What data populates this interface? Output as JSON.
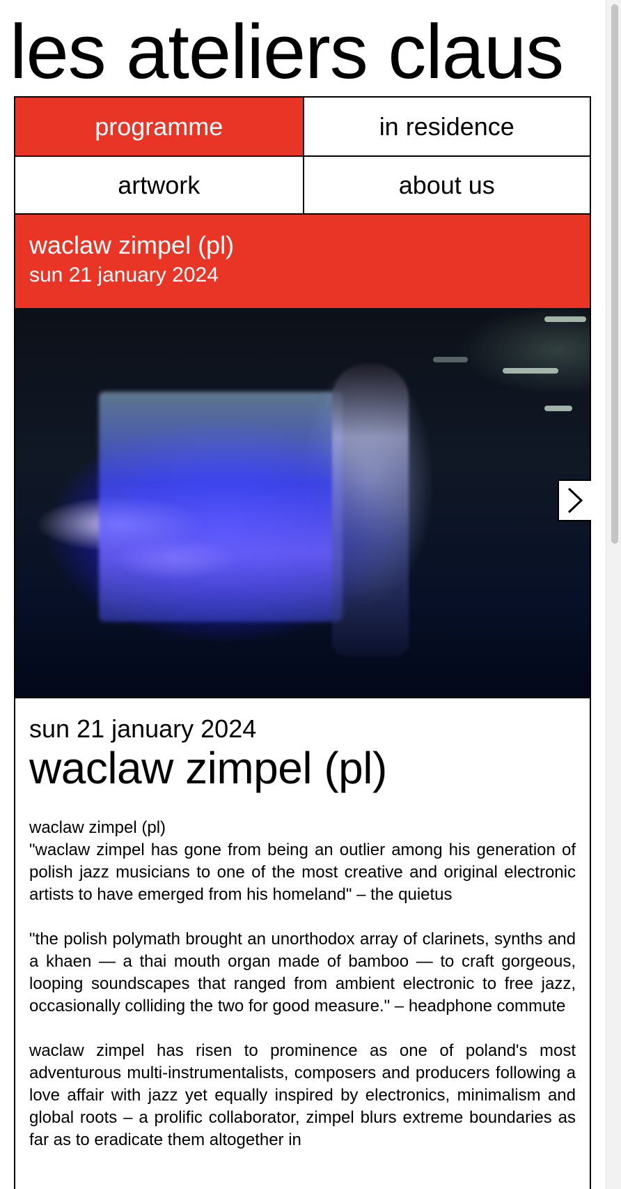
{
  "site": {
    "title": "les ateliers claus"
  },
  "nav": {
    "items": [
      {
        "label": "programme"
      },
      {
        "label": "in residence"
      },
      {
        "label": "artwork"
      },
      {
        "label": "about us"
      }
    ],
    "active": "programme"
  },
  "event_banner": {
    "name": "waclaw zimpel (pl)",
    "date": "sun 21 january 2024"
  },
  "hero": {
    "next_icon": "chevron-right-icon"
  },
  "event": {
    "date": "sun 21 january 2024",
    "title": "waclaw zimpel (pl)",
    "paragraphs": [
      "waclaw zimpel (pl)",
      "\"waclaw zimpel has gone from being an outlier among his generation of polish jazz musicians to one of the most creative and original electronic artists to have emerged from his homeland\" – the quietus",
      "\"the polish polymath brought an unorthodox array of clarinets, synths and a khaen — a thai mouth organ made of bamboo — to craft gorgeous, looping soundscapes that ranged from ambient electronic to free jazz, occasionally colliding the two for good measure.\" – headphone commute",
      "waclaw zimpel has risen to prominence as one of poland's most adventurous multi-instrumentalists, composers and producers following a love affair with jazz yet equally inspired by electronics, minimalism and global roots – a prolific collaborator, zimpel blurs extreme boundaries as far as to eradicate them altogether in"
    ]
  },
  "colors": {
    "accent": "#e83526",
    "border": "#000000",
    "background": "#ffffff"
  }
}
